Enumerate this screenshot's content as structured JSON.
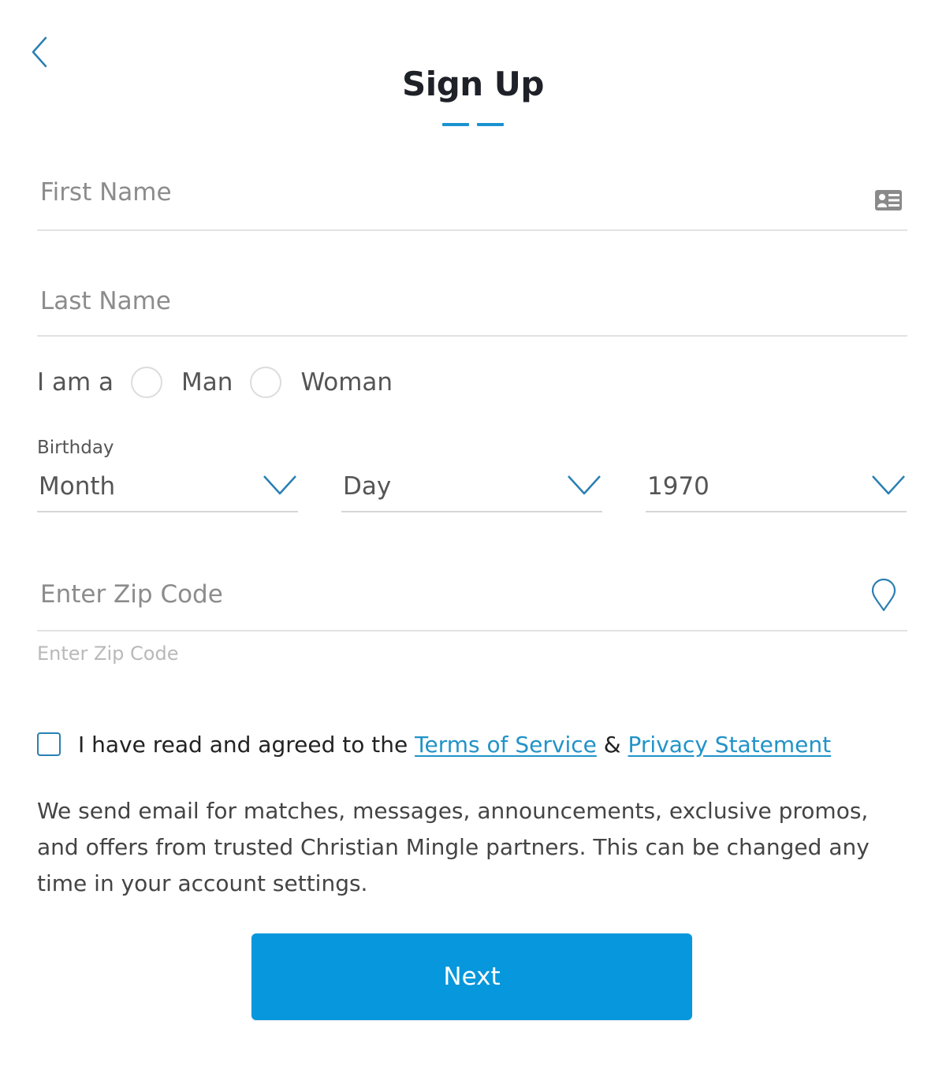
{
  "header": {
    "back_icon": "chevron-left-icon",
    "title": "Sign Up",
    "steps_total": 2,
    "accent_color": "#1b92d0"
  },
  "form": {
    "first_name": {
      "value": "",
      "placeholder": "First Name",
      "icon": "contact-card-icon"
    },
    "last_name": {
      "value": "",
      "placeholder": "Last Name"
    },
    "gender": {
      "label": "I am a",
      "options": [
        {
          "label": "Man",
          "selected": false
        },
        {
          "label": "Woman",
          "selected": false
        }
      ]
    },
    "birthday": {
      "label": "Birthday",
      "month": {
        "value": "Month"
      },
      "day": {
        "value": "Day"
      },
      "year": {
        "value": "1970"
      }
    },
    "zip": {
      "value": "",
      "placeholder": "Enter Zip Code",
      "hint": "Enter Zip Code",
      "icon": "map-pin-icon"
    },
    "terms": {
      "checked": false,
      "prefix": "I have read and agreed to the",
      "terms_link": "Terms of Service",
      "joiner": "&",
      "privacy_link": "Privacy Statement"
    },
    "disclaimer": "We send email for matches, messages, announcements, exclusive promos, and offers from trusted Christian Mingle partners. This can be changed any time in your account settings.",
    "next_label": "Next",
    "button_color": "#0797dc"
  }
}
